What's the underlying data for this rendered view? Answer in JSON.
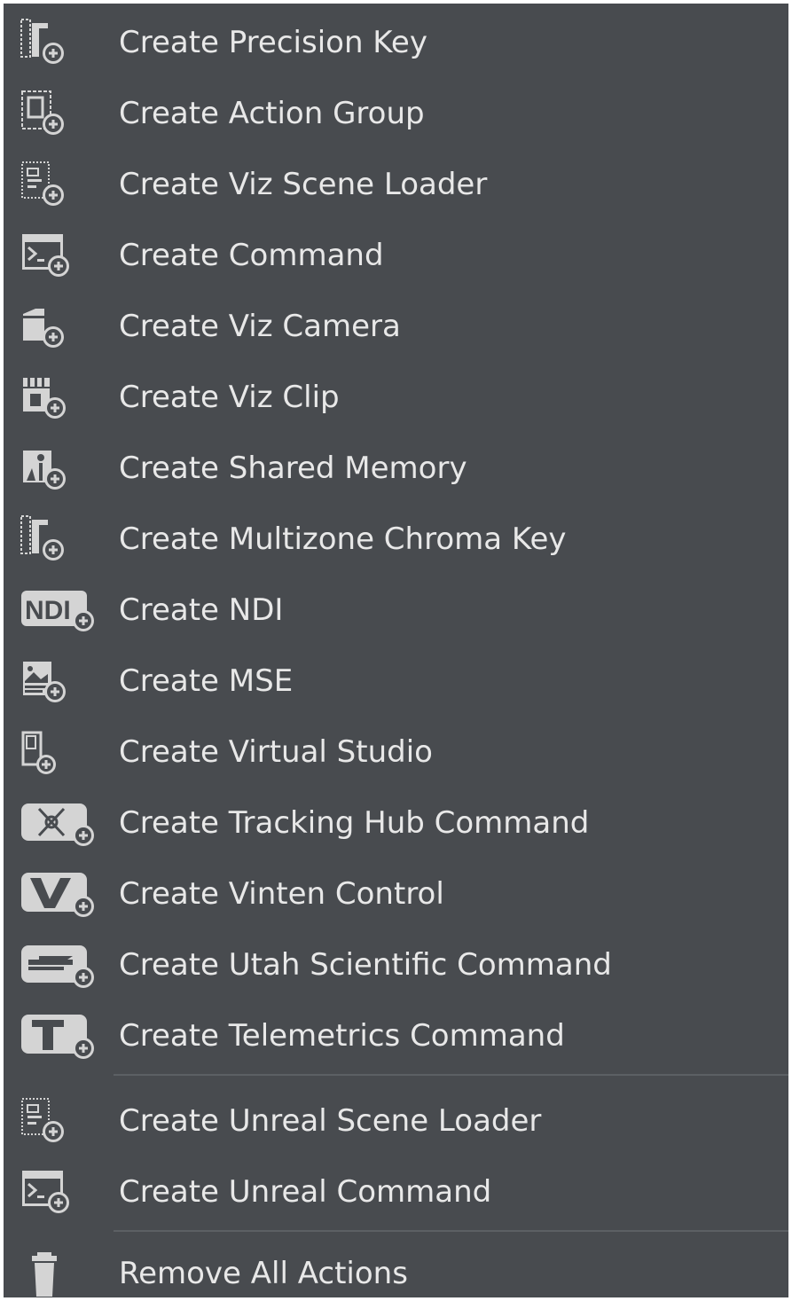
{
  "menu": {
    "items": [
      {
        "label": "Create Precision Key",
        "icon": "precision-key-icon"
      },
      {
        "label": "Create Action Group",
        "icon": "action-group-icon"
      },
      {
        "label": "Create Viz Scene Loader",
        "icon": "scene-loader-icon"
      },
      {
        "label": "Create Command",
        "icon": "terminal-icon"
      },
      {
        "label": "Create Viz Camera",
        "icon": "camera-icon"
      },
      {
        "label": "Create Viz Clip",
        "icon": "clapperboard-icon"
      },
      {
        "label": "Create Shared Memory",
        "icon": "shared-memory-icon"
      },
      {
        "label": "Create Multizone Chroma Key",
        "icon": "chroma-key-icon"
      },
      {
        "label": "Create NDI",
        "icon": "ndi-icon"
      },
      {
        "label": "Create MSE",
        "icon": "mse-icon"
      },
      {
        "label": "Create Virtual Studio",
        "icon": "virtual-studio-icon"
      },
      {
        "label": "Create Tracking Hub Command",
        "icon": "tracking-hub-icon"
      },
      {
        "label": "Create Vinten Control",
        "icon": "vinten-icon"
      },
      {
        "label": "Create Utah Scientific Command",
        "icon": "utah-scientific-icon"
      },
      {
        "label": "Create Telemetrics Command",
        "icon": "telemetrics-icon"
      },
      {
        "label": "Create Unreal Scene Loader",
        "icon": "scene-loader-icon"
      },
      {
        "label": "Create Unreal Command",
        "icon": "terminal-icon"
      },
      {
        "label": "Remove All Actions",
        "icon": "trash-icon"
      }
    ]
  },
  "colors": {
    "background": "#484b4f",
    "text": "#e8e8e8",
    "icon": "#d4d4d4",
    "separator": "#5c6064"
  }
}
